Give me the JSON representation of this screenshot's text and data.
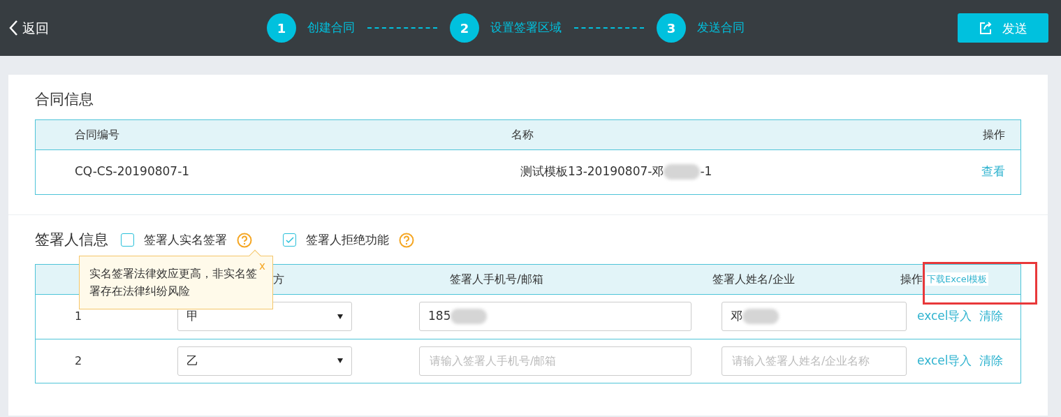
{
  "header": {
    "back": "返回",
    "steps": [
      {
        "number": "1",
        "label": "创建合同"
      },
      {
        "number": "2",
        "label": "设置签署区域"
      },
      {
        "number": "3",
        "label": "发送合同"
      }
    ],
    "send_button": "发送"
  },
  "contract_info": {
    "title": "合同信息",
    "columns": [
      "合同编号",
      "名称",
      "操作"
    ],
    "rows": [
      {
        "number": "CQ-CS-20190807-1",
        "name": "测试模板13-20190807-邓",
        "name_suffix": "-1",
        "action": "查看"
      }
    ]
  },
  "signer_info": {
    "title": "签署人信息",
    "options": [
      {
        "label": "签署人实名签署",
        "checked": false
      },
      {
        "label": "签署人拒绝功能",
        "checked": true
      }
    ],
    "tooltip": {
      "text": "实名签署法律效应更高，非实名签署存在法律纠纷风险",
      "close": "x"
    },
    "columns": [
      "方",
      "签署人手机号/邮箱",
      "签署人姓名/企业",
      "操作"
    ],
    "download_link": {
      "label": "下载Excel模板",
      "highlighted": true
    },
    "rows": [
      {
        "index": "1",
        "party": "甲",
        "phone": {
          "value": "185"
        },
        "name": {
          "value": "邓"
        },
        "actions": [
          "excel导入",
          "清除"
        ]
      },
      {
        "index": "2",
        "party": "乙",
        "phone": {
          "placeholder": "请输入签署人手机号/邮箱"
        },
        "name": {
          "placeholder": "请输入签署人姓名/企业名称"
        },
        "actions": [
          "excel导入",
          "清除"
        ]
      }
    ]
  }
}
